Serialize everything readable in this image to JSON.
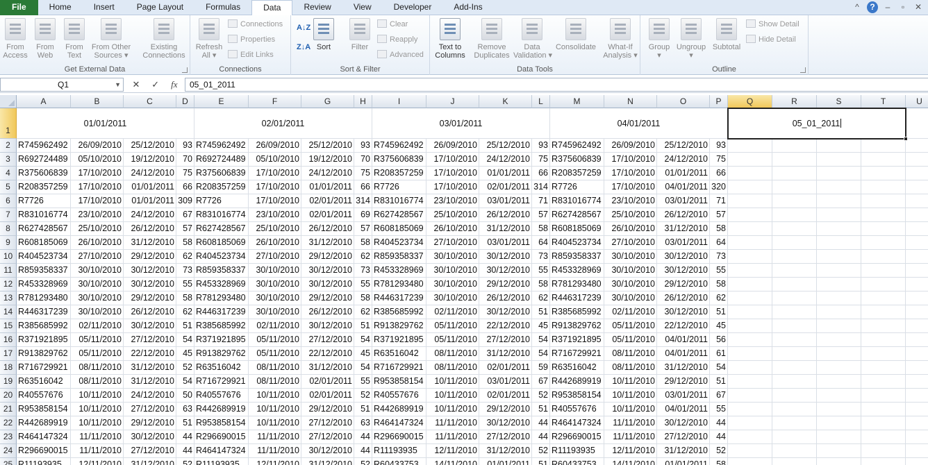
{
  "tabs": [
    "File",
    "Home",
    "Insert",
    "Page Layout",
    "Formulas",
    "Data",
    "Review",
    "View",
    "Developer",
    "Add-Ins"
  ],
  "active_tab": "Data",
  "window_icons": {
    "minimize_ribbon": "^",
    "help": "?",
    "minimize": "–",
    "restore": "▫",
    "close": "✕"
  },
  "ribbon": {
    "get_external_data": {
      "label": "Get External Data",
      "buttons": [
        {
          "line1": "From",
          "line2": "Access"
        },
        {
          "line1": "From",
          "line2": "Web"
        },
        {
          "line1": "From",
          "line2": "Text"
        },
        {
          "line1": "From Other",
          "line2": "Sources ▾"
        },
        {
          "line1": "Existing",
          "line2": "Connections"
        }
      ]
    },
    "connections": {
      "label": "Connections",
      "refresh": {
        "line1": "Refresh",
        "line2": "All ▾"
      },
      "small": [
        "Connections",
        "Properties",
        "Edit Links"
      ]
    },
    "sort_filter": {
      "label": "Sort & Filter",
      "az": "A↓Z",
      "za": "Z↓A",
      "sort": "Sort",
      "filter": "Filter",
      "small": [
        "Clear",
        "Reapply",
        "Advanced"
      ]
    },
    "data_tools": {
      "label": "Data Tools",
      "buttons": [
        {
          "line1": "Text to",
          "line2": "Columns"
        },
        {
          "line1": "Remove",
          "line2": "Duplicates"
        },
        {
          "line1": "Data",
          "line2": "Validation ▾"
        },
        {
          "line1": "Consolidate",
          "line2": ""
        },
        {
          "line1": "What-If",
          "line2": "Analysis ▾"
        }
      ]
    },
    "outline": {
      "label": "Outline",
      "buttons": [
        {
          "line1": "Group",
          "line2": "▾"
        },
        {
          "line1": "Ungroup",
          "line2": "▾"
        },
        {
          "line1": "Subtotal",
          "line2": ""
        }
      ],
      "small": [
        "Show Detail",
        "Hide Detail"
      ]
    }
  },
  "formula_bar": {
    "name_box": "Q1",
    "fx": "fx",
    "cancel": "✕",
    "enter": "✓",
    "value": "05_01_2011"
  },
  "columns": [
    "A",
    "B",
    "C",
    "D",
    "E",
    "F",
    "G",
    "H",
    "I",
    "J",
    "K",
    "L",
    "M",
    "N",
    "O",
    "P",
    "Q",
    "R",
    "S",
    "T",
    "U"
  ],
  "selected_column": "Q",
  "selected_row": "1",
  "row_numbers": [
    "1",
    "2",
    "3",
    "4",
    "5",
    "6",
    "7",
    "8",
    "9",
    "10",
    "11",
    "12",
    "13",
    "14",
    "15",
    "16",
    "17",
    "18",
    "19",
    "20",
    "21",
    "22",
    "23",
    "24",
    "25"
  ],
  "header_dates": [
    "01/01/2011",
    "02/01/2011",
    "03/01/2011",
    "04/01/2011"
  ],
  "active_cell_value": "05_01_2011",
  "rows": [
    [
      "R745962492",
      "26/09/2010",
      "25/12/2010",
      "93",
      "R745962492",
      "26/09/2010",
      "25/12/2010",
      "93",
      "R745962492",
      "26/09/2010",
      "25/12/2010",
      "93",
      "R745962492",
      "26/09/2010",
      "25/12/2010",
      "93"
    ],
    [
      "R692724489",
      "05/10/2010",
      "19/12/2010",
      "70",
      "R692724489",
      "05/10/2010",
      "19/12/2010",
      "70",
      "R375606839",
      "17/10/2010",
      "24/12/2010",
      "75",
      "R375606839",
      "17/10/2010",
      "24/12/2010",
      "75"
    ],
    [
      "R375606839",
      "17/10/2010",
      "24/12/2010",
      "75",
      "R375606839",
      "17/10/2010",
      "24/12/2010",
      "75",
      "R208357259",
      "17/10/2010",
      "01/01/2011",
      "66",
      "R208357259",
      "17/10/2010",
      "01/01/2011",
      "66"
    ],
    [
      "R208357259",
      "17/10/2010",
      "01/01/2011",
      "66",
      "R208357259",
      "17/10/2010",
      "01/01/2011",
      "66",
      "R7726",
      "17/10/2010",
      "02/01/2011",
      "314",
      "R7726",
      "17/10/2010",
      "04/01/2011",
      "320"
    ],
    [
      "R7726",
      "17/10/2010",
      "01/01/2011",
      "309",
      "R7726",
      "17/10/2010",
      "02/01/2011",
      "314",
      "R831016774",
      "23/10/2010",
      "03/01/2011",
      "71",
      "R831016774",
      "23/10/2010",
      "03/01/2011",
      "71"
    ],
    [
      "R831016774",
      "23/10/2010",
      "24/12/2010",
      "67",
      "R831016774",
      "23/10/2010",
      "02/01/2011",
      "69",
      "R627428567",
      "25/10/2010",
      "26/12/2010",
      "57",
      "R627428567",
      "25/10/2010",
      "26/12/2010",
      "57"
    ],
    [
      "R627428567",
      "25/10/2010",
      "26/12/2010",
      "57",
      "R627428567",
      "25/10/2010",
      "26/12/2010",
      "57",
      "R608185069",
      "26/10/2010",
      "31/12/2010",
      "58",
      "R608185069",
      "26/10/2010",
      "31/12/2010",
      "58"
    ],
    [
      "R608185069",
      "26/10/2010",
      "31/12/2010",
      "58",
      "R608185069",
      "26/10/2010",
      "31/12/2010",
      "58",
      "R404523734",
      "27/10/2010",
      "03/01/2011",
      "64",
      "R404523734",
      "27/10/2010",
      "03/01/2011",
      "64"
    ],
    [
      "R404523734",
      "27/10/2010",
      "29/12/2010",
      "62",
      "R404523734",
      "27/10/2010",
      "29/12/2010",
      "62",
      "R859358337",
      "30/10/2010",
      "30/12/2010",
      "73",
      "R859358337",
      "30/10/2010",
      "30/12/2010",
      "73"
    ],
    [
      "R859358337",
      "30/10/2010",
      "30/12/2010",
      "73",
      "R859358337",
      "30/10/2010",
      "30/12/2010",
      "73",
      "R453328969",
      "30/10/2010",
      "30/12/2010",
      "55",
      "R453328969",
      "30/10/2010",
      "30/12/2010",
      "55"
    ],
    [
      "R453328969",
      "30/10/2010",
      "30/12/2010",
      "55",
      "R453328969",
      "30/10/2010",
      "30/12/2010",
      "55",
      "R781293480",
      "30/10/2010",
      "29/12/2010",
      "58",
      "R781293480",
      "30/10/2010",
      "29/12/2010",
      "58"
    ],
    [
      "R781293480",
      "30/10/2010",
      "29/12/2010",
      "58",
      "R781293480",
      "30/10/2010",
      "29/12/2010",
      "58",
      "R446317239",
      "30/10/2010",
      "26/12/2010",
      "62",
      "R446317239",
      "30/10/2010",
      "26/12/2010",
      "62"
    ],
    [
      "R446317239",
      "30/10/2010",
      "26/12/2010",
      "62",
      "R446317239",
      "30/10/2010",
      "26/12/2010",
      "62",
      "R385685992",
      "02/11/2010",
      "30/12/2010",
      "51",
      "R385685992",
      "02/11/2010",
      "30/12/2010",
      "51"
    ],
    [
      "R385685992",
      "02/11/2010",
      "30/12/2010",
      "51",
      "R385685992",
      "02/11/2010",
      "30/12/2010",
      "51",
      "R913829762",
      "05/11/2010",
      "22/12/2010",
      "45",
      "R913829762",
      "05/11/2010",
      "22/12/2010",
      "45"
    ],
    [
      "R371921895",
      "05/11/2010",
      "27/12/2010",
      "54",
      "R371921895",
      "05/11/2010",
      "27/12/2010",
      "54",
      "R371921895",
      "05/11/2010",
      "27/12/2010",
      "54",
      "R371921895",
      "05/11/2010",
      "04/01/2011",
      "56"
    ],
    [
      "R913829762",
      "05/11/2010",
      "22/12/2010",
      "45",
      "R913829762",
      "05/11/2010",
      "22/12/2010",
      "45",
      "R63516042",
      "08/11/2010",
      "31/12/2010",
      "54",
      "R716729921",
      "08/11/2010",
      "04/01/2011",
      "61"
    ],
    [
      "R716729921",
      "08/11/2010",
      "31/12/2010",
      "52",
      "R63516042",
      "08/11/2010",
      "31/12/2010",
      "54",
      "R716729921",
      "08/11/2010",
      "02/01/2011",
      "59",
      "R63516042",
      "08/11/2010",
      "31/12/2010",
      "54"
    ],
    [
      "R63516042",
      "08/11/2010",
      "31/12/2010",
      "54",
      "R716729921",
      "08/11/2010",
      "02/01/2011",
      "55",
      "R953858154",
      "10/11/2010",
      "03/01/2011",
      "67",
      "R442689919",
      "10/11/2010",
      "29/12/2010",
      "51"
    ],
    [
      "R40557676",
      "10/11/2010",
      "24/12/2010",
      "50",
      "R40557676",
      "10/11/2010",
      "02/01/2011",
      "52",
      "R40557676",
      "10/11/2010",
      "02/01/2011",
      "52",
      "R953858154",
      "10/11/2010",
      "03/01/2011",
      "67"
    ],
    [
      "R953858154",
      "10/11/2010",
      "27/12/2010",
      "63",
      "R442689919",
      "10/11/2010",
      "29/12/2010",
      "51",
      "R442689919",
      "10/11/2010",
      "29/12/2010",
      "51",
      "R40557676",
      "10/11/2010",
      "04/01/2011",
      "55"
    ],
    [
      "R442689919",
      "10/11/2010",
      "29/12/2010",
      "51",
      "R953858154",
      "10/11/2010",
      "27/12/2010",
      "63",
      "R464147324",
      "11/11/2010",
      "30/12/2010",
      "44",
      "R464147324",
      "11/11/2010",
      "30/12/2010",
      "44"
    ],
    [
      "R464147324",
      "11/11/2010",
      "30/12/2010",
      "44",
      "R296690015",
      "11/11/2010",
      "27/12/2010",
      "44",
      "R296690015",
      "11/11/2010",
      "27/12/2010",
      "44",
      "R296690015",
      "11/11/2010",
      "27/12/2010",
      "44"
    ],
    [
      "R296690015",
      "11/11/2010",
      "27/12/2010",
      "44",
      "R464147324",
      "11/11/2010",
      "30/12/2010",
      "44",
      "R11193935",
      "12/11/2010",
      "31/12/2010",
      "52",
      "R11193935",
      "12/11/2010",
      "31/12/2010",
      "52"
    ],
    [
      "R11193935",
      "12/11/2010",
      "31/12/2010",
      "52",
      "R11193935",
      "12/11/2010",
      "31/12/2010",
      "52",
      "R60433753",
      "14/11/2010",
      "01/01/2011",
      "51",
      "R60433753",
      "14/11/2010",
      "01/01/2011",
      "58"
    ]
  ]
}
